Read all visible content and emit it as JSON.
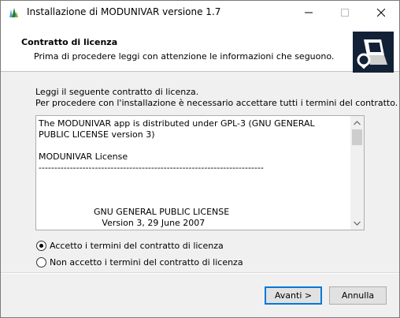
{
  "window": {
    "title": "Installazione di MODUNIVAR versione 1.7",
    "minimize_glyph": "—",
    "maximize_glyph": "☐",
    "close_glyph": "✕"
  },
  "header": {
    "title": "Contratto di licenza",
    "subtitle": "Prima di procedere leggi con attenzione le informazioni che seguono."
  },
  "intro": {
    "line1": "Leggi il seguente contratto di licenza.",
    "line2": "Per procedere con l'installazione è necessario accettare tutti i termini del contratto."
  },
  "license": {
    "text": "The MODUNIVAR app is distributed under GPL-3 (GNU GENERAL PUBLIC LICENSE version 3)\n\nMODUNIVAR License\n------------------------------------------------------------------------\n\n\n\n                    GNU GENERAL PUBLIC LICENSE\n                       Version 3, 29 June 2007",
    "scroll_position": 0.0
  },
  "options": {
    "accept_label": "Accetto i termini del contratto di licenza",
    "decline_label": "Non accetto i termini del contratto di licenza",
    "selected": "accept"
  },
  "buttons": {
    "next_label": "Avanti >",
    "cancel_label": "Annulla"
  },
  "colors": {
    "accent": "#0078d7",
    "logo_bg": "#132136"
  }
}
